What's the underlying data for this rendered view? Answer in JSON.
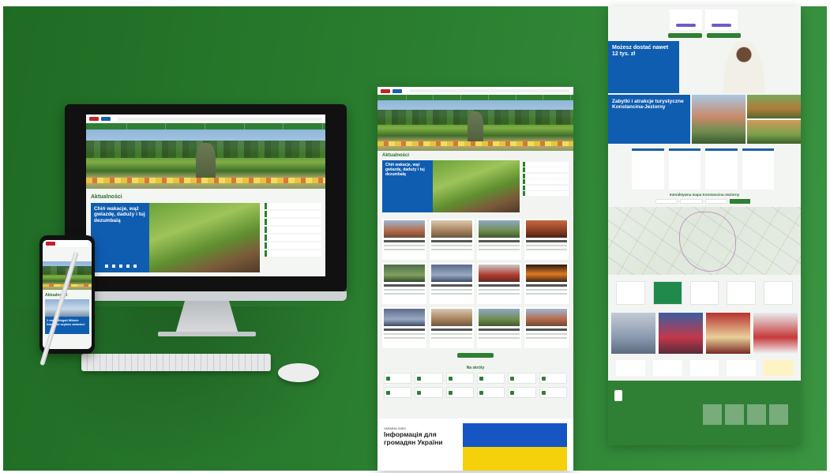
{
  "mockup": {
    "colors": {
      "backdrop": "#2a7d2f",
      "brand_green": "#2f7f34",
      "feature_blue": "#0f5db0",
      "ukraine_blue": "#1556c2",
      "ukraine_yellow": "#f5d10b"
    },
    "imac": {
      "news_heading": "Aktualności",
      "feature_title": "Chiń wakacje, wąż gwiazdę, daduży i tuj dezumbalą"
    },
    "phone": {
      "news_heading": "Aktualności",
      "feature_title": "1 maja Biegali Wiśnie Sobieski szybko zaświeci"
    },
    "middle_page": {
      "news_heading": "Aktualności",
      "feature_title": "Chiń wakacje, wąż gwiazdę, daduży i tuj dezumbalą",
      "shortcuts_heading": "Na skróty",
      "ukraine_kicker": "УКРАЇНА ІНФО",
      "ukraine_title": "Інформація для громадян України"
    },
    "right_page": {
      "promo_title": "Możesz dostać nawet 12 tys. zł",
      "tour_title": "Zabytki i atrakcje turystyczne Konstancina-Jeziorny",
      "map_heading": "Interaktywna mapa Konstancina-Jeziorny"
    }
  }
}
